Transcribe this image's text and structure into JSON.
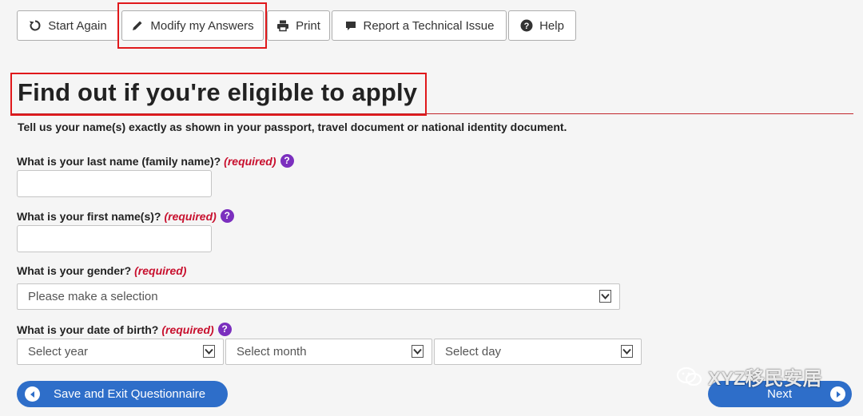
{
  "toolbar": {
    "start_again": "Start Again",
    "modify_answers": "Modify my Answers",
    "print": "Print",
    "report_issue": "Report a Technical Issue",
    "help": "Help"
  },
  "page": {
    "title": "Find out if you're eligible to apply",
    "intro": "Tell us your name(s) exactly as shown in your passport, travel document or national identity document."
  },
  "form": {
    "required_text": "(required)",
    "help_glyph": "?",
    "last_name": {
      "label": "What is your last name (family name)?",
      "value": ""
    },
    "first_name": {
      "label": "What is your first name(s)?",
      "value": ""
    },
    "gender": {
      "label": "What is your gender?",
      "value": "Please make a selection"
    },
    "dob": {
      "label": "What is your date of birth?",
      "year": "Select year",
      "month": "Select month",
      "day": "Select day"
    }
  },
  "actions": {
    "save_exit": "Save and Exit Questionnaire",
    "next": "Next"
  },
  "watermark": "XYZ移民安居",
  "colors": {
    "accent_blue": "#2e6ec9",
    "required_red": "#c8102e",
    "help_purple": "#7b2fbe",
    "highlight_red": "#e0181b",
    "title_rule": "#c1272d"
  }
}
